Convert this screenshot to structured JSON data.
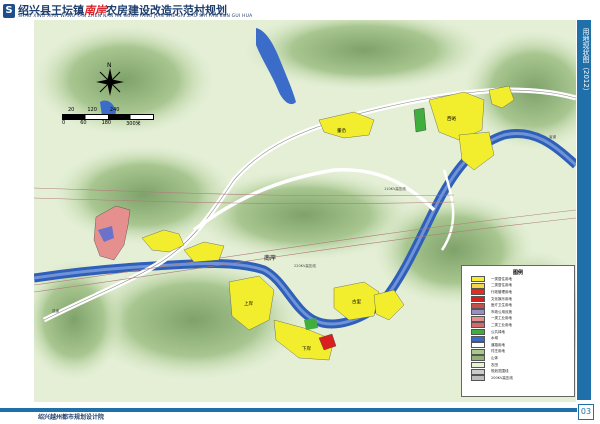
{
  "header": {
    "logo_char": "S",
    "title_pre": "绍兴县王坛镇",
    "title_hl": "南岸",
    "title_post": "农房建设改造示范村规划",
    "pinyin": "SHAO XING XIAN WANG TAN ZHEN NAN AN NONG FANG JIAN SHE GAI ZAO SHI FAN CUN GUI HUA"
  },
  "sidebar": {
    "label": "用地现状图（2012）"
  },
  "footer": {
    "org": "绍兴越州都市规划设计院",
    "page": "03"
  },
  "map": {
    "places": {
      "nan_an": "南岸",
      "dong_an": "董岙",
      "xi_yu": "西峪",
      "gu_li": "古里",
      "shang_an": "上岸",
      "xia_an": "下岸"
    },
    "roads": {
      "r1": "110KV高压线",
      "r2": "220KV高压线",
      "r3": "省道",
      "r4": "县道"
    },
    "colors": {
      "water": "#3b6cc9",
      "river": "#2f5fb8",
      "terrain": "#b6d3a0",
      "residential": "#f2ee2e",
      "public": "#d91f1f",
      "industrial": "#e58f8f",
      "road": "#ffffff"
    }
  },
  "scale": {
    "ticks": [
      "0",
      "60",
      "180",
      "300米"
    ],
    "small": [
      "20",
      "120",
      "240"
    ]
  },
  "north": {
    "label": "N"
  },
  "legend": {
    "title": "图例",
    "items": [
      {
        "label": "一类居住用地",
        "color": "#f2ee2e"
      },
      {
        "label": "二类居住用地",
        "color": "#f5d64a"
      },
      {
        "label": "行政管理用地",
        "color": "#e0301e"
      },
      {
        "label": "文化娱乐用地",
        "color": "#d91f1f"
      },
      {
        "label": "医疗卫生用地",
        "color": "#c4504d"
      },
      {
        "label": "市政公用设施",
        "color": "#9a8fc4"
      },
      {
        "label": "一类工业用地",
        "color": "#e58f8f"
      },
      {
        "label": "二类工业用地",
        "color": "#d26b6b"
      },
      {
        "label": "公共绿地",
        "color": "#3fae3f"
      },
      {
        "label": "水域",
        "color": "#3b6cc9"
      },
      {
        "label": "道路用地",
        "color": "#ffffff"
      },
      {
        "label": "村庄用地",
        "color": "#a7c98a"
      },
      {
        "label": "山体",
        "color": "#8fb276"
      },
      {
        "label": "农田",
        "color": "#e7f2d8"
      },
      {
        "label": "规划范围线",
        "color": "#cccccc"
      },
      {
        "label": "200KV高压线",
        "color": "#bdbdbd"
      }
    ]
  }
}
